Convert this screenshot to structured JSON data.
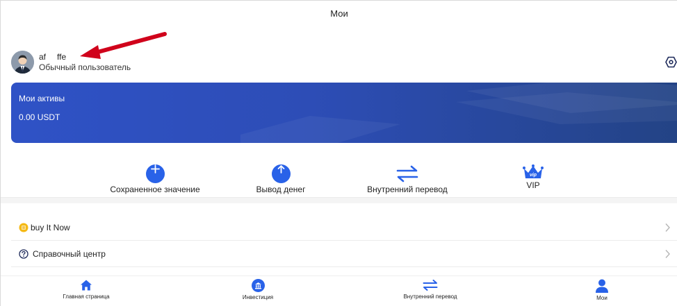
{
  "header": {
    "title": "Мои"
  },
  "profile": {
    "username_start": "af",
    "username_end": "ffe",
    "level": "Обычный пользователь"
  },
  "assets": {
    "title": "Мои активы",
    "value": "0.00 USDT"
  },
  "actions": [
    {
      "label": "Сохраненное значение",
      "icon": "plus-icon"
    },
    {
      "label": "Вывод денег",
      "icon": "arrow-up-icon"
    },
    {
      "label": "Внутренний перевод",
      "icon": "transfer-icon"
    },
    {
      "label": "VIP",
      "icon": "vip-crown-icon"
    }
  ],
  "menu": [
    {
      "label": "buy It Now",
      "icon": "coin-icon"
    },
    {
      "label": "Справочный центр",
      "icon": "help-icon"
    }
  ],
  "bottom_nav": [
    {
      "label": "Главная страница",
      "icon": "home-icon"
    },
    {
      "label": "Инвестиция",
      "icon": "invest-icon"
    },
    {
      "label": "Внутренний перевод",
      "icon": "transfer-icon"
    },
    {
      "label": "Мои",
      "icon": "user-icon"
    }
  ],
  "colors": {
    "accent": "#2962e8",
    "card_start": "#2f52c6",
    "card_end": "#234385",
    "annotation_arrow": "#d0021b"
  }
}
